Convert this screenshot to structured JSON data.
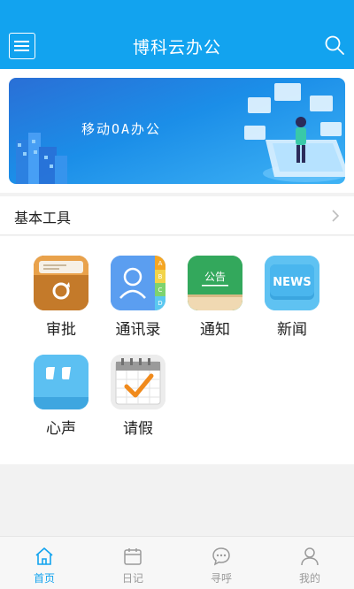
{
  "header": {
    "title": "博科云办公",
    "menu_icon": "hamburger-menu-icon",
    "search_icon": "search-icon",
    "bg_color": "#12a3ef"
  },
  "banner": {
    "text": "移动OA办公"
  },
  "section": {
    "title": "基本工具",
    "chevron_icon": "chevron-right-icon"
  },
  "tools": [
    {
      "label": "审批",
      "icon": "approval-icon"
    },
    {
      "label": "通讯录",
      "icon": "contacts-icon"
    },
    {
      "label": "通知",
      "icon": "notice-board-icon",
      "icon_text": "公告"
    },
    {
      "label": "新闻",
      "icon": "news-icon",
      "icon_text": "NEWS"
    },
    {
      "label": "心声",
      "icon": "quote-bubble-icon"
    },
    {
      "label": "请假",
      "icon": "calendar-check-icon"
    }
  ],
  "contacts_tabs": [
    "A",
    "B",
    "C",
    "D"
  ],
  "bottom_nav": [
    {
      "label": "首页",
      "icon": "home-icon",
      "active": true
    },
    {
      "label": "日记",
      "icon": "diary-icon",
      "active": false
    },
    {
      "label": "寻呼",
      "icon": "chat-bubble-icon",
      "active": false
    },
    {
      "label": "我的",
      "icon": "user-icon",
      "active": false
    }
  ],
  "colors": {
    "accent": "#12a3ef",
    "inactive": "#9a9a9a"
  }
}
